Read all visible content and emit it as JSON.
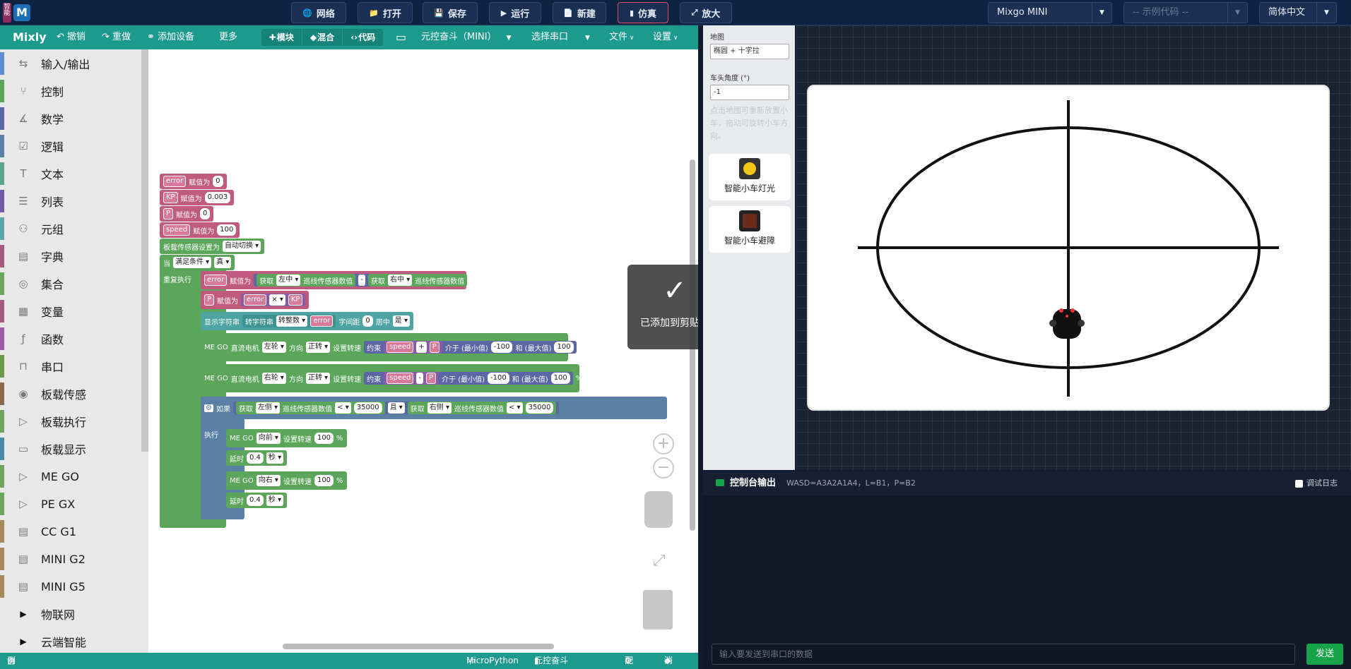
{
  "topbar": {
    "logo_small": "智能",
    "logo_big": "M",
    "buttons": [
      {
        "label": "网络",
        "icon": "globe-icon"
      },
      {
        "label": "打开",
        "icon": "folder-icon"
      },
      {
        "label": "保存",
        "icon": "save-icon"
      },
      {
        "label": "运行",
        "icon": "play-icon"
      },
      {
        "label": "新建",
        "icon": "file-icon"
      },
      {
        "label": "仿真",
        "icon": "sim-icon"
      },
      {
        "label": "放大",
        "icon": "expand-icon"
      }
    ],
    "board_select": "Mixgo MINI",
    "example_select": "-- 示例代码 --",
    "lang_select": "简体中文"
  },
  "toolbar": {
    "brand": "Mixly",
    "undo": "撤销",
    "redo": "重做",
    "add_device": "添加设备",
    "more": "更多",
    "mode_blocks": "模块",
    "mode_mixed": "混合",
    "mode_code": "代码",
    "board": "元控奋斗（MINI）",
    "serial": "选择串口",
    "file": "文件",
    "settings": "设置"
  },
  "categories": [
    {
      "label": "输入/输出",
      "color": "#5b8ccc"
    },
    {
      "label": "控制",
      "color": "#5ba65b"
    },
    {
      "label": "数学",
      "color": "#5b67a5"
    },
    {
      "label": "逻辑",
      "color": "#5b80a5"
    },
    {
      "label": "文本",
      "color": "#5ba58c"
    },
    {
      "label": "列表",
      "color": "#745ba5"
    },
    {
      "label": "元组",
      "color": "#5ba5a5"
    },
    {
      "label": "字典",
      "color": "#a55b80"
    },
    {
      "label": "集合",
      "color": "#6aa55b"
    },
    {
      "label": "变量",
      "color": "#a55b80"
    },
    {
      "label": "函数",
      "color": "#995ba5"
    },
    {
      "label": "串口",
      "color": "#6a9a4a"
    },
    {
      "label": "板载传感",
      "color": "#8a6a4a"
    },
    {
      "label": "板载执行",
      "color": "#6aa55b"
    },
    {
      "label": "板载显示",
      "color": "#4a8aa5"
    },
    {
      "label": "ME GO",
      "color": "#6aa55b"
    },
    {
      "label": "PE GX",
      "color": "#6aa55b"
    },
    {
      "label": "CC G1",
      "color": "#a58a5b"
    },
    {
      "label": "MINI G2",
      "color": "#a58a5b"
    },
    {
      "label": "MINI G5",
      "color": "#a58a5b"
    },
    {
      "label": "物联网",
      "color": "#e8e8e8"
    },
    {
      "label": "云端智能",
      "color": "#e8e8e8"
    }
  ],
  "blocks": {
    "v_error": "error",
    "assign": "赋值为",
    "n0": "0",
    "v_kp": "KP",
    "n_kp": "0.003",
    "v_p": "P",
    "v_speed": "speed",
    "n100": "100",
    "sensor_mode": "板载传感器设置为",
    "auto": "自动切换",
    "when": "当",
    "cond": "满足条件",
    "true_val": "真",
    "repeat": "重复执行",
    "get": "获取",
    "left_mid": "左中",
    "right_mid": "右中",
    "line_sensor": "巡线传感器数值",
    "minus": "-",
    "times": "×",
    "show_str": "显示字符串",
    "to_str": "转字符串",
    "to_int": "转整数",
    "spacing": "字间距",
    "center": "居中",
    "yes": "是",
    "mego": "ME GO",
    "dc_motor": "直流电机",
    "left_wheel": "左轮",
    "right_wheel": "右轮",
    "dir": "方向",
    "fwd": "正转",
    "set_speed": "设置转速",
    "constrain": "约束",
    "plus": "+",
    "between_min": "介于 (最小值)",
    "neg100": "-100",
    "and_max": "和 (最大值)",
    "pct": "%",
    "if": "如果",
    "do": "执行",
    "left_side": "获取",
    "left_opt": "左侧",
    "right_opt": "右侧",
    "lt": "<",
    "n35000": "35000",
    "and": "且",
    "forward": "向前",
    "right_turn": "向右",
    "delay": "延时",
    "n04": "0.4",
    "sec": "秒"
  },
  "toast": "已添加到剪贴板",
  "sim": {
    "map_label": "地图",
    "map_value": "椭圆 + 十字拉",
    "heading_label": "车头角度 (°)",
    "heading_value": "-1",
    "hint": "点击地图可重新放置小车，拖动可旋转小车方向。",
    "card1": "智能小车灯光",
    "card2": "智能小车避障"
  },
  "console": {
    "title": "控制台输出",
    "keys": "WASD=A3A2A1A4，L=B1，P=B2",
    "debug": "调试日志",
    "placeholder": "输入要发送到串口的数据",
    "send": "发送"
  },
  "status": {
    "examples": "例程",
    "lang": "MicroPython",
    "board": "元控奋斗（MINI）",
    "config": "配置",
    "msg": "消息"
  }
}
